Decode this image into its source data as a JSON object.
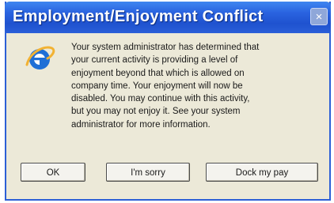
{
  "dialog": {
    "title": "Employment/Enjoyment Conflict",
    "close_glyph": "×",
    "icon": "internet-explorer-icon",
    "message_lines": [
      "Your system administrator has determined that",
      "your current activity is providing a level of",
      "enjoyment beyond that which is allowed on",
      "company time. Your enjoyment will now be",
      "disabled. You may continue with this activity,",
      "but you may not enjoy it. See your system",
      "administrator for more information."
    ],
    "buttons": {
      "ok": "OK",
      "sorry": "I'm sorry",
      "dock": "Dock my pay"
    }
  },
  "colors": {
    "titlebar": "#2a63e0",
    "body": "#ece9d8",
    "ie_blue": "#1f6fd6",
    "ie_ring": "#f2b233"
  }
}
